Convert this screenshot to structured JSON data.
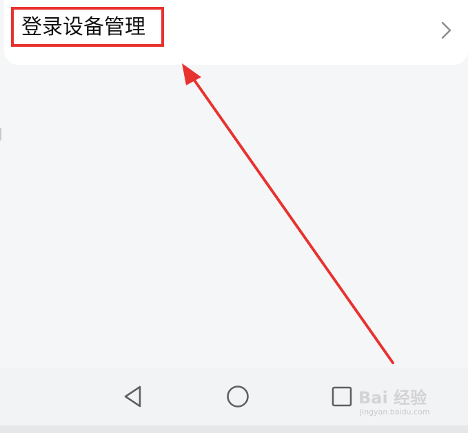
{
  "settings_item": {
    "label": "登录设备管理"
  },
  "icons": {
    "chevron": "chevron-right-icon",
    "back": "back-triangle-icon",
    "home": "home-circle-icon",
    "recent": "recent-apps-square-icon"
  },
  "annotation": {
    "highlight_color": "#e8322f",
    "arrow_color": "#e8322f"
  },
  "watermark": {
    "brand": "Bai 经验",
    "url": "jingyan.baidu.com"
  }
}
